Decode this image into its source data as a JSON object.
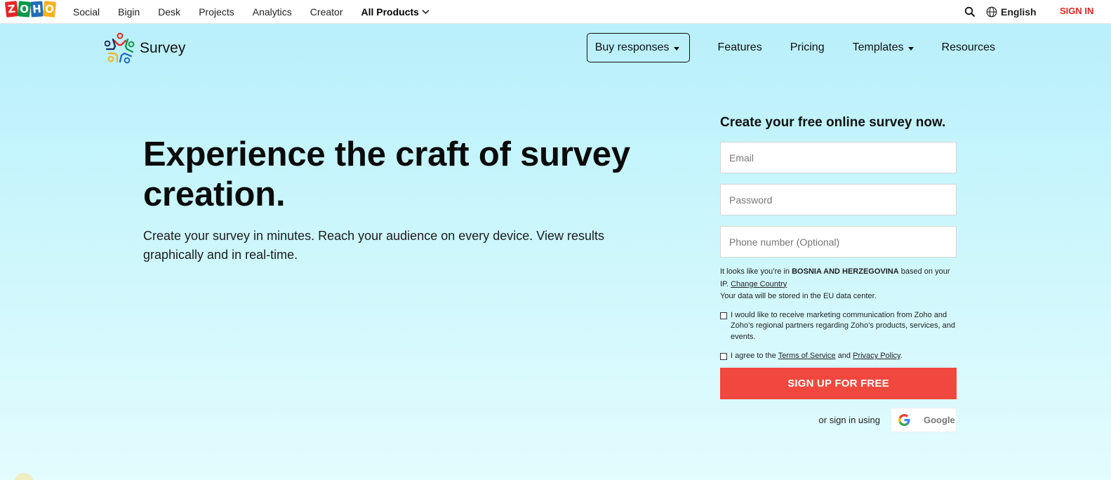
{
  "topbar": {
    "logo_letters": [
      "Z",
      "O",
      "H",
      "O"
    ],
    "logo_colors": [
      "#e42527",
      "#089949",
      "#226db4",
      "#f9b21d"
    ],
    "products": [
      "Social",
      "Bigin",
      "Desk",
      "Projects",
      "Analytics",
      "Creator"
    ],
    "all_products_label": "All Products",
    "language": "English",
    "sign_in_label": "SIGN IN",
    "icons": [
      "search-icon",
      "globe-icon",
      "chevron-down-icon"
    ]
  },
  "header": {
    "brand_name": "Survey",
    "buy_responses_label": "Buy responses",
    "nav": {
      "features": "Features",
      "pricing": "Pricing",
      "templates": "Templates",
      "resources": "Resources"
    }
  },
  "hero": {
    "title": "Experience the craft of survey creation.",
    "subtitle": "Create your survey in minutes. Reach your audience on every device. View results graphically and in real-time."
  },
  "signup_form": {
    "title": "Create your free online survey now.",
    "email_placeholder": "Email",
    "password_placeholder": "Password",
    "phone_placeholder": "Phone number (Optional)",
    "geo_prefix": "It looks like you’re in",
    "country": "BOSNIA AND HERZEGOVINA",
    "geo_suffix": "based on your IP.",
    "change_country_label": "Change Country",
    "data_center_note": "Your data will be stored in the EU data center.",
    "marketing_consent": "I would like to receive marketing communication from Zoho and Zoho’s regional partners regarding Zoho’s products, services, and events.",
    "terms_prefix": "I agree to the",
    "terms_link": "Terms of Service",
    "terms_and": "and",
    "privacy_link": "Privacy Policy",
    "terms_suffix": ".",
    "submit_label": "SIGN UP FOR FREE",
    "alt_sign_in_label": "or sign in using",
    "google_label": "Google"
  },
  "colors": {
    "accent_red": "#f0483e",
    "sign_in_red": "#e42527",
    "background_top": "#b7effb"
  }
}
